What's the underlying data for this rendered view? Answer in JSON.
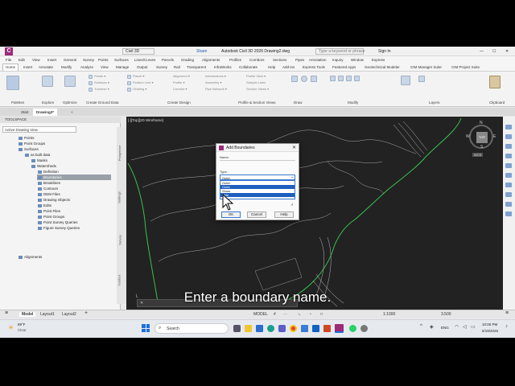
{
  "title_bar": {
    "workspace": "Civil 3D",
    "share": "Share",
    "app_title": "Autodesk Civil 3D 2026   Drawing2.dwg",
    "search_placeholder": "Type a keyword or phrase",
    "sign_in": "Sign In"
  },
  "menu": [
    "File",
    "Edit",
    "View",
    "Insert",
    "General",
    "Survey",
    "Points",
    "Surfaces",
    "Lines/Curves",
    "Parcels",
    "Grading",
    "Alignments",
    "Profiles",
    "Corridors",
    "Sections",
    "Pipes",
    "Annotation",
    "Inquiry",
    "Window",
    "Express"
  ],
  "ribbon_tabs": [
    "Home",
    "Insert",
    "Annotate",
    "Modify",
    "Analyze",
    "View",
    "Manage",
    "Output",
    "Survey",
    "Rail",
    "Transparent",
    "InfraWorks",
    "Collaborate",
    "Help",
    "Add-ins",
    "Express Tools",
    "Featured Apps",
    "Geotechnical Modeler",
    "CIM Manager Suite",
    "CIM Project Suite"
  ],
  "ribbon_panels": [
    "Palettes",
    "Explore",
    "Optimize",
    "Create Ground Data",
    "Create Design",
    "Profile & Section Views",
    "Draw",
    "Modify",
    "Layers",
    "Clipboard"
  ],
  "doc_tabs": [
    "Start",
    "Drawing2*"
  ],
  "toolspace": {
    "title": "TOOLSPACE",
    "view": "Active Drawing View",
    "tree": [
      "Points",
      "Point Groups",
      "Surfaces",
      "as built data",
      "Masks",
      "Watersheds",
      "Definition",
      "Boundaries",
      "Breaklines",
      "Contours",
      "DEM Files",
      "Drawing Objects",
      "Edits",
      "Point Files",
      "Point Groups",
      "Point Survey Queries",
      "Figure Survey Queries",
      "Alignments"
    ]
  },
  "side_tabs": [
    "Prospector",
    "Settings",
    "Survey",
    "Toolbox"
  ],
  "viewport": {
    "label": "[-][Top][2D Wireframe]",
    "navcube_top": "TOP",
    "compass": {
      "n": "N",
      "s": "S",
      "e": "E",
      "w": "W"
    },
    "wcs": "WCS"
  },
  "dialog": {
    "title": "Add Boundaries",
    "name_label": "Name:",
    "type_label": "Type:",
    "type_value": "Outer",
    "options": [
      "Outer",
      "Outer",
      "Show",
      "Hide"
    ],
    "ok": "OK",
    "cancel": "Cancel",
    "help": "Help"
  },
  "layout_tabs": [
    "Model",
    "Layout1",
    "Layout2"
  ],
  "status": {
    "model": "MODEL",
    "scale": "1:1000",
    "coord": "3.500"
  },
  "taskbar": {
    "weather_temp": "89°F",
    "weather_desc": "Clear",
    "search": "Search",
    "lang": "ENG",
    "time": "10:00 PM",
    "date": "6/19/2026"
  },
  "caption": "Enter a boundary name."
}
